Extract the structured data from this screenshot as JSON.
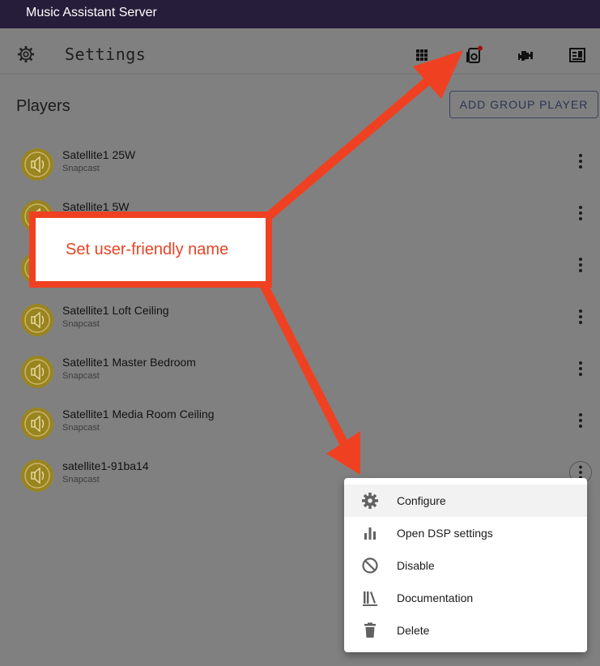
{
  "window": {
    "title": "Music Assistant Server"
  },
  "header": {
    "title": "Settings",
    "icons": [
      "gear-icon",
      "grid-icon",
      "speaker-icon",
      "engine-icon",
      "person-card-icon"
    ]
  },
  "players_section": {
    "title": "Players",
    "add_group_label": "ADD GROUP PLAYER",
    "players": [
      {
        "name": "Satellite1 25W",
        "provider": "Snapcast"
      },
      {
        "name": "Satellite1 5W",
        "provider": ""
      },
      {
        "name": "",
        "provider": ""
      },
      {
        "name": "Satellite1 Loft Ceiling",
        "provider": "Snapcast"
      },
      {
        "name": "Satellite1 Master Bedroom",
        "provider": "Snapcast"
      },
      {
        "name": "Satellite1 Media Room Ceiling",
        "provider": "Snapcast"
      },
      {
        "name": "satellite1-91ba14",
        "provider": "Snapcast"
      }
    ]
  },
  "context_menu": {
    "items": [
      {
        "label": "Configure",
        "icon": "gear-icon"
      },
      {
        "label": "Open DSP settings",
        "icon": "bar-chart-icon"
      },
      {
        "label": "Disable",
        "icon": "block-icon"
      },
      {
        "label": "Documentation",
        "icon": "library-icon"
      },
      {
        "label": "Delete",
        "icon": "trash-icon"
      }
    ]
  },
  "annotation": {
    "text": "Set user-friendly name"
  },
  "colors": {
    "titlebar": "#251d39",
    "dim_background": "#808080",
    "avatar": "#9a8420",
    "annotation_red": "#ef4122"
  }
}
